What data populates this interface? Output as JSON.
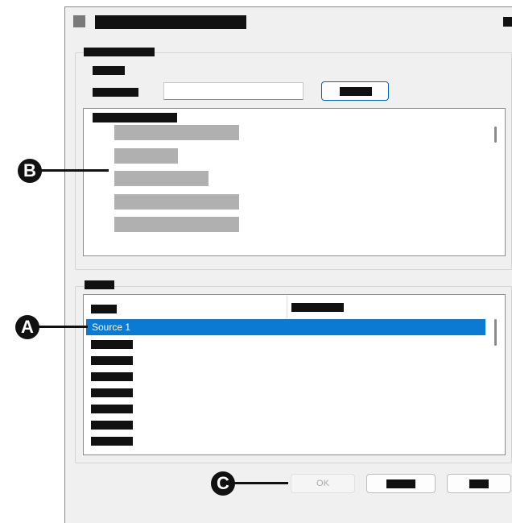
{
  "callouts": {
    "a": "A",
    "b": "B",
    "c": "C"
  },
  "sources_list": {
    "selected_item": "Source 1"
  },
  "buttons": {
    "ok_label": "OK"
  },
  "colors": {
    "selection": "#0a7ad2",
    "accent_border": "#0067c0",
    "redaction": "#111111",
    "placeholder_bar": "#b0b0b0"
  }
}
